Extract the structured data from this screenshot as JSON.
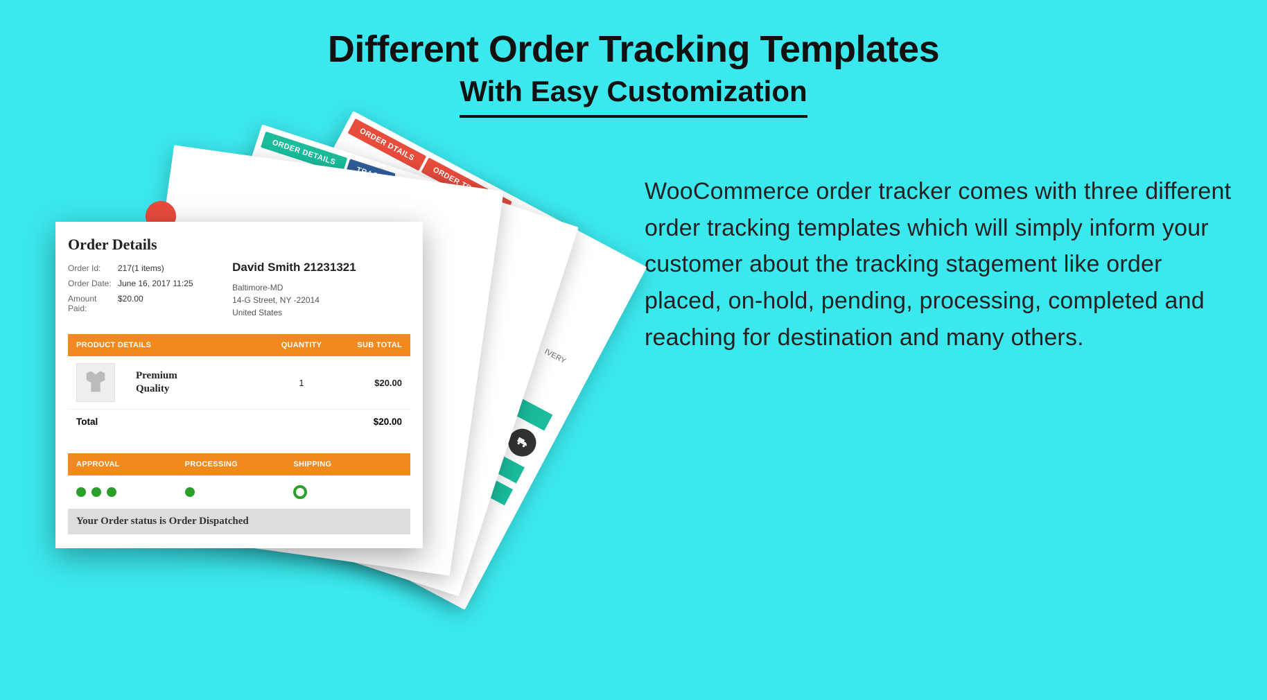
{
  "heading": {
    "title": "Different Order Tracking Templates",
    "subtitle": "With Easy Customization"
  },
  "description": "WooCommerce order tracker comes with three different order tracking templates which will simply inform your customer about the tracking stagement like order placed, on-hold, pending, processing, completed and reaching for destination and many others.",
  "stack_tabs": {
    "card3": {
      "t1": "ORDER DTAILS",
      "t2": "ORDER TRACKING"
    },
    "card2": {
      "t1": "ORDER DETAILS",
      "t2": "TRACK"
    },
    "card1_delivery_label": "Delivery",
    "delivery_heading": "IVERY"
  },
  "order": {
    "section_title": "Order Details",
    "id_label": "Order Id:",
    "id_value": "217(1 items)",
    "date_label": "Order Date:",
    "date_value": "June 16, 2017 11:25",
    "paid_label": "Amount Paid:",
    "paid_value": "$20.00",
    "customer_name": "David Smith 21231321",
    "addr1": "Baltimore-MD",
    "addr2": "14-G Street, NY -22014",
    "addr3": "United States"
  },
  "product_table": {
    "h_name": "PRODUCT DETAILS",
    "h_qty": "QUANTITY",
    "h_sub": "SUB TOTAL",
    "desc_line1": "Premium",
    "desc_line2": "Quality",
    "qty": "1",
    "sub": "$20.00",
    "total_label": "Total",
    "total_value": "$20.00"
  },
  "tracking": {
    "h1": "APPROVAL",
    "h2": "PROCESSING",
    "h3": "SHIPPING",
    "status_text": "Your Order status is Order Dispatched"
  }
}
